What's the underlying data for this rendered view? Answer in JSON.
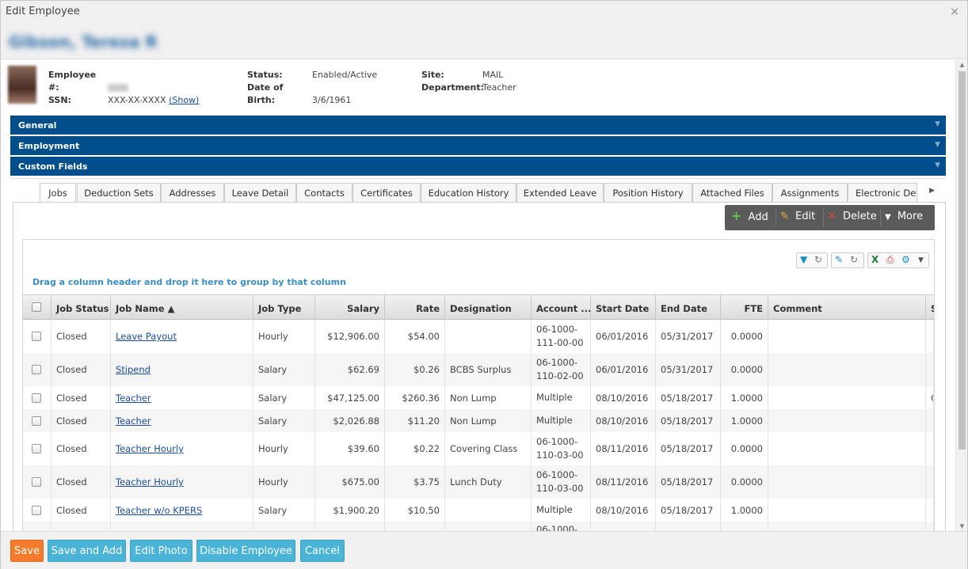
{
  "window": {
    "title": "Edit Employee",
    "close_icon": "×",
    "employee_name": "Gibson, Teresa R"
  },
  "employee": {
    "emp_num_label": "Employee #:",
    "ssn_label": "SSN:",
    "ssn_value": "XXX-XX-XXXX",
    "ssn_show": "(Show)",
    "status_label": "Status:",
    "status_value": "Enabled/Active",
    "dob_label": "Date of Birth:",
    "dob_value": "3/6/1961",
    "site_label": "Site:",
    "site_value": "MAIL",
    "dept_label": "Department:",
    "dept_value": "Teacher"
  },
  "sections": [
    "General",
    "Employment",
    "Custom Fields"
  ],
  "tabs": [
    "Jobs",
    "Deduction Sets",
    "Addresses",
    "Leave Detail",
    "Contacts",
    "Certificates",
    "Education History",
    "Extended Leave",
    "Position History",
    "Attached Files",
    "Assignments",
    "Electronic Del"
  ],
  "toolbar": {
    "add": "Add",
    "edit": "Edit",
    "delete": "Delete",
    "more": "More"
  },
  "grid": {
    "group_hint": "Drag a column header and drop it here to group by that column",
    "columns": [
      "Job Status",
      "Job Name ▲",
      "Job Type",
      "Salary",
      "Rate",
      "Designation",
      "Account ...",
      "Start Date",
      "End Date",
      "FTE",
      "Comment",
      "S"
    ],
    "rows": [
      {
        "status": "Closed",
        "name": "Leave Payout",
        "type": "Hourly",
        "salary": "$12,906.00",
        "rate": "$54.00",
        "designation": "",
        "account": "06-1000-\n111-00-00",
        "start": "06/01/2016",
        "end": "05/31/2017",
        "fte": "0.0000",
        "comment": "",
        "extra": ""
      },
      {
        "status": "Closed",
        "name": "Stipend",
        "type": "Salary",
        "salary": "$62.69",
        "rate": "$0.26",
        "designation": "BCBS Surplus",
        "account": "06-1000-\n110-02-00",
        "start": "06/01/2016",
        "end": "05/31/2017",
        "fte": "0.0000",
        "comment": "",
        "extra": ""
      },
      {
        "status": "Closed",
        "name": "Teacher",
        "type": "Salary",
        "salary": "$47,125.00",
        "rate": "$260.36",
        "designation": "Non Lump",
        "account": "Multiple",
        "start": "08/10/2016",
        "end": "05/18/2017",
        "fte": "1.0000",
        "comment": "",
        "extra": "C"
      },
      {
        "status": "Closed",
        "name": "Teacher",
        "type": "Salary",
        "salary": "$2,026.88",
        "rate": "$11.20",
        "designation": "Non Lump",
        "account": "Multiple",
        "start": "08/10/2016",
        "end": "05/18/2017",
        "fte": "1.0000",
        "comment": "",
        "extra": ""
      },
      {
        "status": "Closed",
        "name": "Teacher Hourly",
        "type": "Hourly",
        "salary": "$39.60",
        "rate": "$0.22",
        "designation": "Covering Class",
        "account": "06-1000-\n110-03-00",
        "start": "08/11/2016",
        "end": "05/18/2017",
        "fte": "0.0000",
        "comment": "",
        "extra": ""
      },
      {
        "status": "Closed",
        "name": "Teacher Hourly",
        "type": "Hourly",
        "salary": "$675.00",
        "rate": "$3.75",
        "designation": "Lunch Duty",
        "account": "06-1000-\n110-03-00",
        "start": "08/11/2016",
        "end": "05/18/2017",
        "fte": "0.0000",
        "comment": "",
        "extra": ""
      },
      {
        "status": "Closed",
        "name": "Teacher w/o KPERS",
        "type": "Salary",
        "salary": "$1,900.20",
        "rate": "$10.50",
        "designation": "",
        "account": "Multiple",
        "start": "08/10/2016",
        "end": "05/18/2017",
        "fte": "1.0000",
        "comment": "",
        "extra": ""
      },
      {
        "status": "",
        "name": "",
        "type": "",
        "salary": "",
        "rate": "",
        "designation": "",
        "account": "06-1000-",
        "start": "",
        "end": "",
        "fte": "",
        "comment": "",
        "extra": ""
      }
    ]
  },
  "footer": {
    "save": "Save",
    "save_add": "Save and Add",
    "edit_photo": "Edit Photo",
    "disable": "Disable Employee",
    "cancel": "Cancel"
  },
  "colors": {
    "section_blue": "#004f8c",
    "save_orange": "#f47b2a",
    "button_blue": "#49b3d8",
    "link": "#1a4d9c"
  }
}
